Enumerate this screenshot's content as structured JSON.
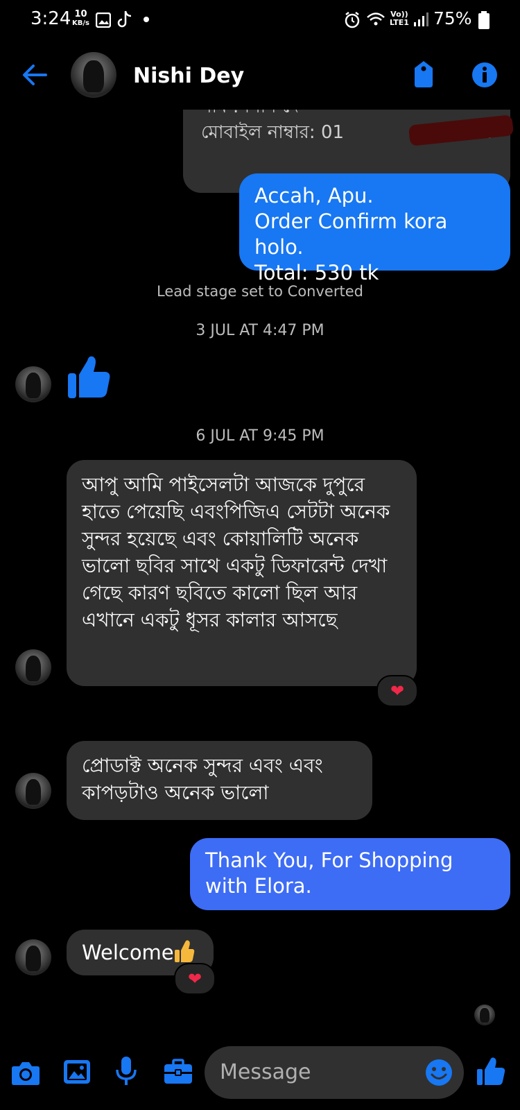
{
  "status_bar": {
    "time": "3:24",
    "speed_value": "10",
    "speed_unit": "KB/s",
    "network": "LTE1",
    "battery": "75%"
  },
  "header": {
    "contact_name": "Nishi Dey"
  },
  "messages": {
    "partial_line1": "নাম : নিশি দে",
    "partial_line2": "মোবাইল নাম্বার: 01",
    "partial_ellipsis": "...",
    "sent_order_line1": "Accah, Apu.",
    "sent_order_line2": "Order Confirm kora holo.",
    "sent_order_line3": "Total: 530 tk",
    "lead_stage": "Lead stage set to Converted",
    "timestamp1": "3 JUL AT 4:47 PM",
    "timestamp2": "6 JUL AT 9:45 PM",
    "recv_long": "আপু আমি পাইসেলটা আজকে দুপুরে হাতে পেয়েছি এবংপিজিএ সেটটা অনেক সুন্দর হয়েছে এবং কোয়ালিটি অনেক ভালো ছবির সাথে একটু ডিফারেন্ট দেখা গেছে কারণ ছবিতে কালো ছিল আর এখানে একটু ধূসর কালার আসছে",
    "recv_product": "প্রোডাক্ট অনেক সুন্দর এবং এবং কাপড়টাও অনেক ভালো",
    "sent_thanks": "Thank You, For Shopping with Elora.",
    "recv_welcome": "Welcome",
    "reaction": "❤"
  },
  "composer": {
    "placeholder": "Message"
  },
  "colors": {
    "accent": "#1877f2",
    "sent_bubble": "#1877f2",
    "sent_bubble_alt": "#3d6cf5",
    "received_bubble": "#303030",
    "background": "#000000"
  }
}
